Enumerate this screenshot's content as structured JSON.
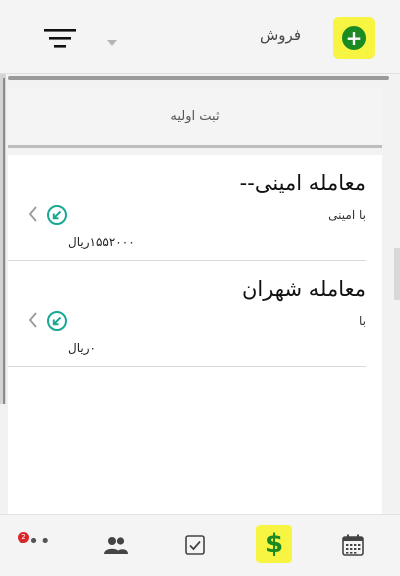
{
  "header": {
    "section_title": "فروش",
    "add_icon": "+"
  },
  "register": {
    "label": "ثبت اولیه"
  },
  "deals": [
    {
      "title": "معامله امینی--",
      "party": "با امینی",
      "amount": "۱۵۵۲۰۰۰ریال"
    },
    {
      "title": "معامله شهران",
      "party": "با",
      "amount": "۰ریال"
    }
  ],
  "bottom_nav": {
    "more_badge": "2",
    "more_icon": "•••",
    "sales_icon": "$"
  },
  "colors": {
    "highlight": "#f7f542",
    "accent_green": "#1b8a22",
    "teal": "#1aa894",
    "badge_red": "#d9262c"
  }
}
